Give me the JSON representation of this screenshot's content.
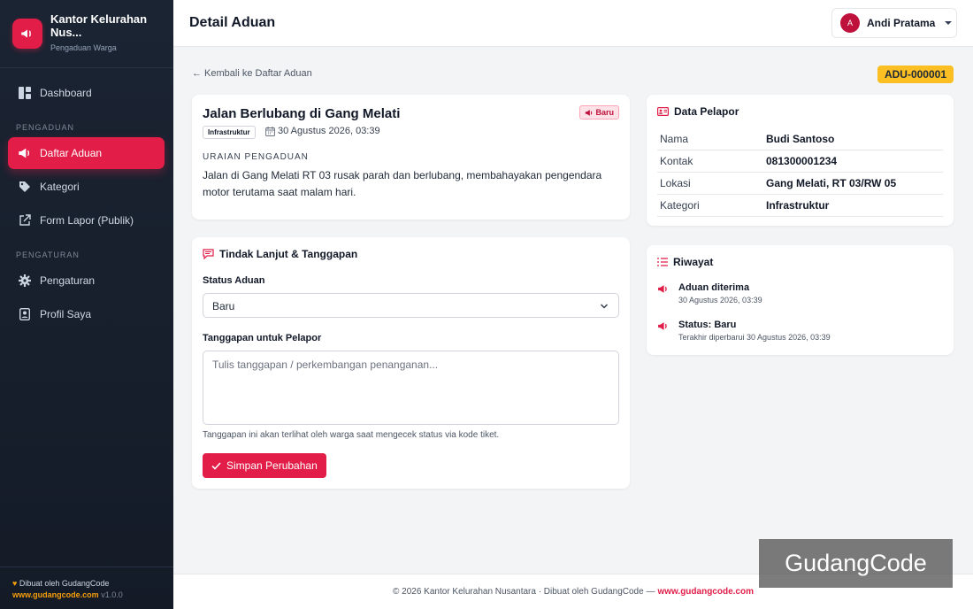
{
  "app": {
    "name": "Kantor Kelurahan Nus...",
    "subtitle": "Pengaduan Warga",
    "accent": "#e11d48"
  },
  "sidebar": {
    "items": [
      {
        "label": "Dashboard",
        "icon": "dashboard-icon"
      },
      {
        "label": "Daftar Aduan",
        "icon": "megaphone-icon",
        "active": true
      },
      {
        "label": "Kategori",
        "icon": "tag-icon"
      },
      {
        "label": "Form Lapor (Publik)",
        "icon": "external-link-icon"
      },
      {
        "label": "Pengaturan",
        "icon": "gear-icon"
      },
      {
        "label": "Profil Saya",
        "icon": "id-badge-icon"
      }
    ],
    "sections": {
      "pengaduan": "PENGADUAN",
      "pengaturan": "PENGATURAN"
    },
    "footer": {
      "made_by": "Dibuat oleh GudangCode",
      "link": "www.gudangcode.com",
      "version": "v1.0.0"
    }
  },
  "header": {
    "title": "Detail Aduan",
    "user": {
      "initial": "A",
      "name": "Andi Pratama"
    }
  },
  "main": {
    "back_link": "← Kembali ke Daftar Aduan",
    "ticket_code": "ADU-000001",
    "complaint": {
      "title": "Jalan Berlubang di Gang Melati",
      "status": "Baru",
      "category": "Infrastruktur",
      "date": "30 Agustus 2026, 03:39",
      "section_label": "URAIAN PENGADUAN",
      "description": "Jalan di Gang Melati RT 03 rusak parah dan berlubang, membahayakan pengendara motor terutama saat malam hari."
    },
    "follow_up": {
      "heading": "Tindak Lanjut & Tanggapan",
      "status_label": "Status Aduan",
      "status_value": "Baru",
      "response_label": "Tanggapan untuk Pelapor",
      "response_placeholder": "Tulis tanggapan / perkembangan penanganan...",
      "helper": "Tanggapan ini akan terlihat oleh warga saat mengecek status via kode tiket.",
      "save_label": "Simpan Perubahan"
    },
    "reporter": {
      "heading": "Data Pelapor",
      "rows": [
        {
          "key": "Nama",
          "value": "Budi Santoso"
        },
        {
          "key": "Kontak",
          "value": "081300001234"
        },
        {
          "key": "Lokasi",
          "value": "Gang Melati, RT 03/RW 05"
        },
        {
          "key": "Kategori",
          "value": "Infrastruktur"
        }
      ]
    },
    "history": {
      "heading": "Riwayat",
      "items": [
        {
          "title": "Aduan diterima",
          "sub": "30 Agustus 2026, 03:39"
        },
        {
          "title": "Status: Baru",
          "sub": "Terakhir diperbarui 30 Agustus 2026, 03:39"
        }
      ]
    }
  },
  "footer": {
    "text": "© 2026 Kantor Kelurahan Nusantara · Dibuat oleh GudangCode —",
    "link": "www.gudangcode.com"
  },
  "watermark": "GudangCode"
}
